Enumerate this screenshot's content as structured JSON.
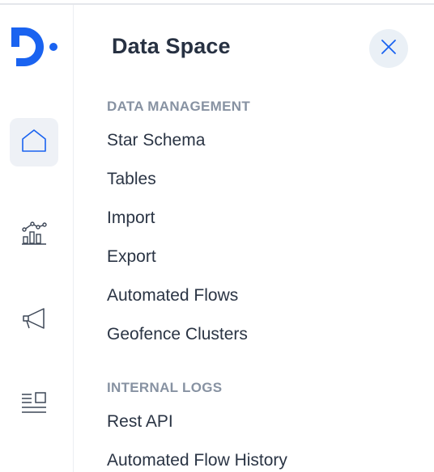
{
  "rail": {
    "logo_icon": "brand-d-logo-icon",
    "items": [
      {
        "icon": "home-icon",
        "active": true
      },
      {
        "icon": "analytics-chart-icon",
        "active": false
      },
      {
        "icon": "megaphone-icon",
        "active": false
      },
      {
        "icon": "content-list-icon",
        "active": false
      }
    ]
  },
  "panel": {
    "title": "Data Space",
    "close_icon": "close-icon",
    "sections": [
      {
        "heading": "DATA MANAGEMENT",
        "items": [
          "Star Schema",
          "Tables",
          "Import",
          "Export",
          "Automated Flows",
          "Geofence Clusters"
        ]
      },
      {
        "heading": "INTERNAL LOGS",
        "items": [
          "Rest API",
          "Automated Flow History"
        ]
      }
    ]
  },
  "colors": {
    "brand": "#1a63f0",
    "title": "#273142",
    "heading": "#8792a2",
    "item": "#2a3444",
    "rail_active_bg": "#eef1f6",
    "close_bg": "#eaf0f6"
  }
}
